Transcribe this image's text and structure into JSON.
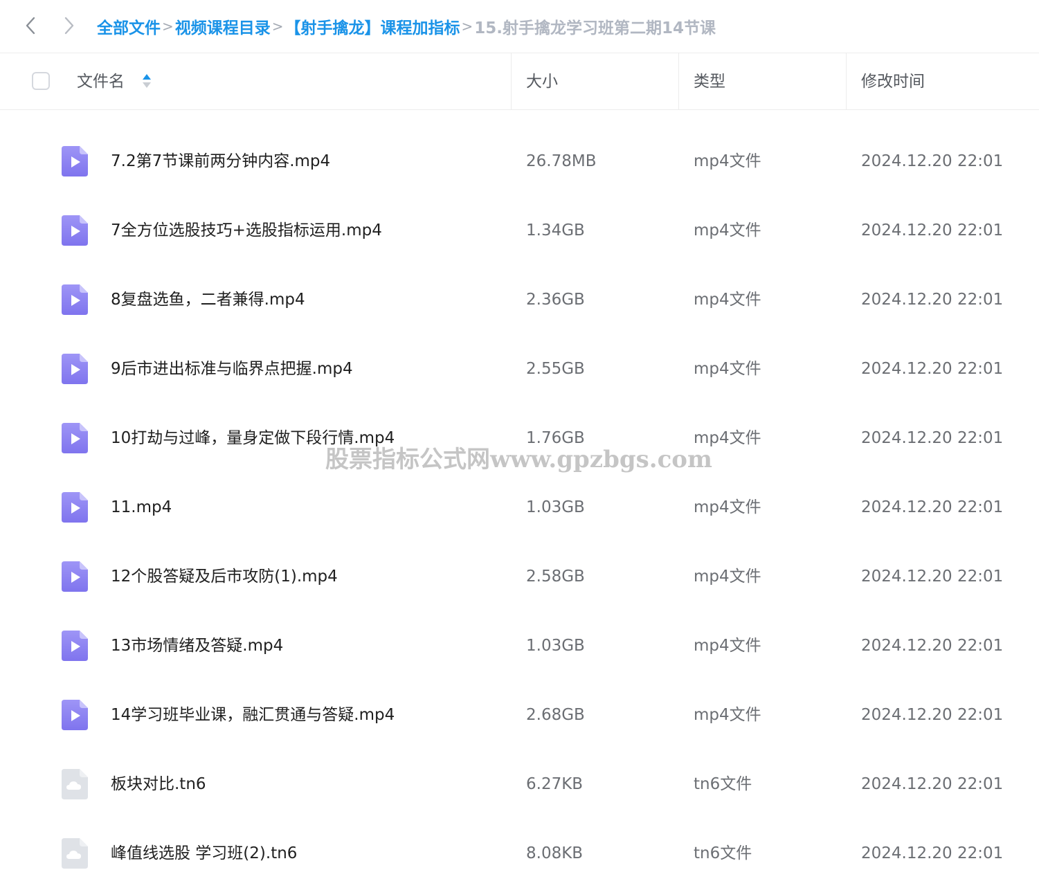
{
  "breadcrumb": {
    "items": [
      "全部文件",
      "视频课程目录",
      "【射手擒龙】课程加指标"
    ],
    "current": "15.射手擒龙学习班第二期14节课",
    "separator": ">"
  },
  "table": {
    "headers": {
      "name": "文件名",
      "size": "大小",
      "type": "类型",
      "modified": "修改时间"
    },
    "rows": [
      {
        "name": "7.2第7节课前两分钟内容.mp4",
        "size": "26.78MB",
        "type": "mp4文件",
        "modified": "2024.12.20 22:01",
        "icon": "video-file-icon"
      },
      {
        "name": "7全方位选股技巧+选股指标运用.mp4",
        "size": "1.34GB",
        "type": "mp4文件",
        "modified": "2024.12.20 22:01",
        "icon": "video-file-icon"
      },
      {
        "name": "8复盘选鱼，二者兼得.mp4",
        "size": "2.36GB",
        "type": "mp4文件",
        "modified": "2024.12.20 22:01",
        "icon": "video-file-icon"
      },
      {
        "name": "9后市进出标准与临界点把握.mp4",
        "size": "2.55GB",
        "type": "mp4文件",
        "modified": "2024.12.20 22:01",
        "icon": "video-file-icon"
      },
      {
        "name": "10打劫与过峰，量身定做下段行情.mp4",
        "size": "1.76GB",
        "type": "mp4文件",
        "modified": "2024.12.20 22:01",
        "icon": "video-file-icon"
      },
      {
        "name": "11.mp4",
        "size": "1.03GB",
        "type": "mp4文件",
        "modified": "2024.12.20 22:01",
        "icon": "video-file-icon"
      },
      {
        "name": "12个股答疑及后市攻防(1).mp4",
        "size": "2.58GB",
        "type": "mp4文件",
        "modified": "2024.12.20 22:01",
        "icon": "video-file-icon"
      },
      {
        "name": "13市场情绪及答疑.mp4",
        "size": "1.03GB",
        "type": "mp4文件",
        "modified": "2024.12.20 22:01",
        "icon": "video-file-icon"
      },
      {
        "name": "14学习班毕业课，融汇贯通与答疑.mp4",
        "size": "2.68GB",
        "type": "mp4文件",
        "modified": "2024.12.20 22:01",
        "icon": "video-file-icon"
      },
      {
        "name": "板块对比.tn6",
        "size": "6.27KB",
        "type": "tn6文件",
        "modified": "2024.12.20 22:01",
        "icon": "cloud-file-icon"
      },
      {
        "name": "峰值线选股 学习班(2).tn6",
        "size": "8.08KB",
        "type": "tn6文件",
        "modified": "2024.12.20 22:01",
        "icon": "cloud-file-icon"
      }
    ]
  },
  "watermark": "股票指标公式网www.gpzbgs.com",
  "colors": {
    "link": "#1a93e8",
    "video_icon_top": "#9e95f6",
    "video_icon_bottom": "#7f74ee",
    "cloud_icon": "#dfe2e7",
    "sort_active": "#1a93e8"
  }
}
